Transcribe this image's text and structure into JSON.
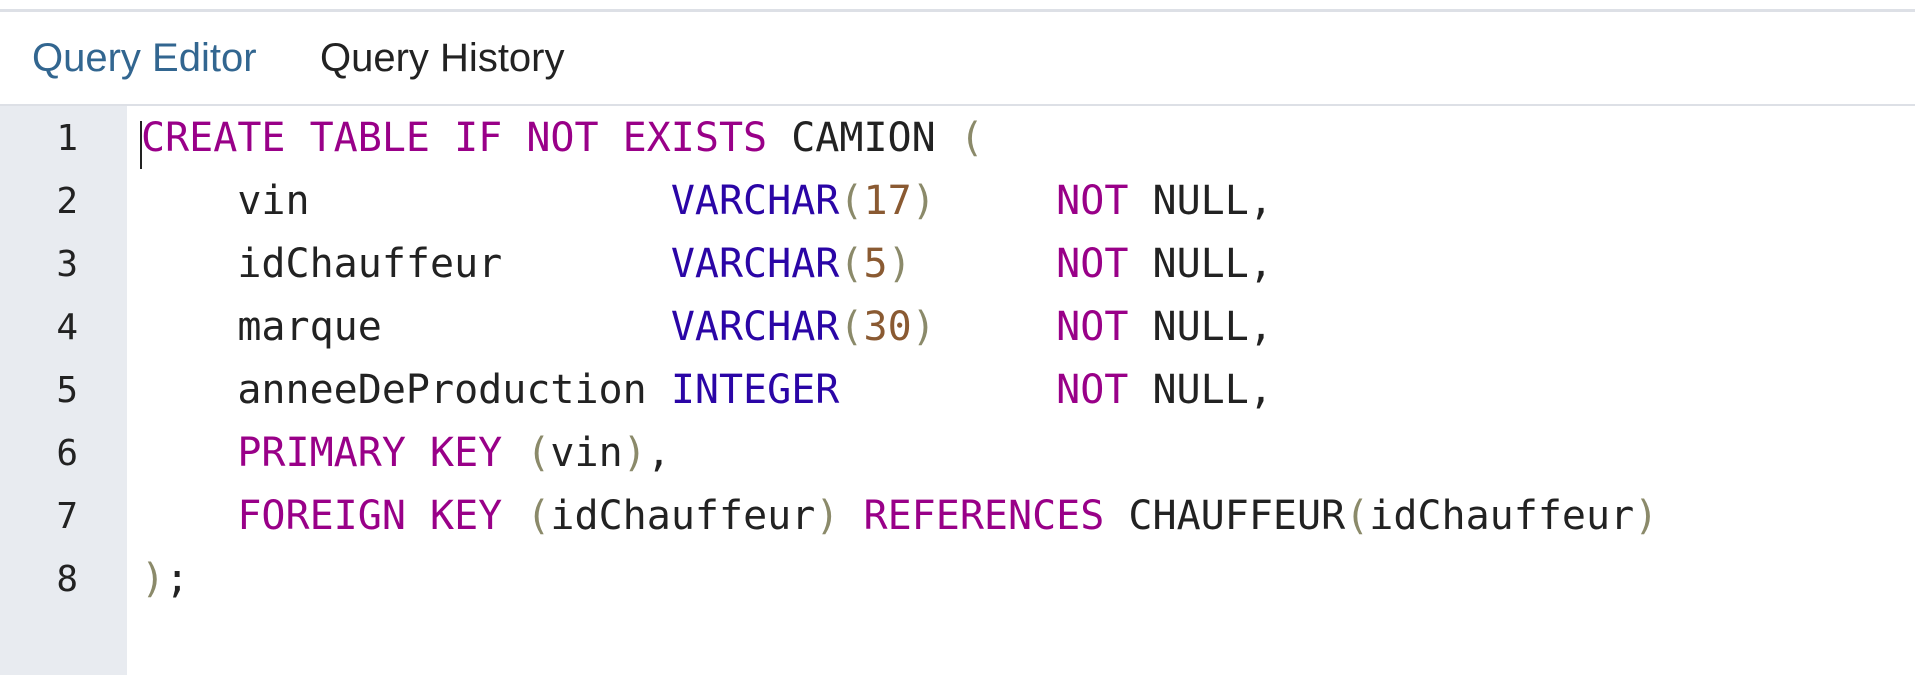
{
  "tabs": [
    {
      "label": "Query Editor",
      "active": true
    },
    {
      "label": "Query History",
      "active": false
    }
  ],
  "colors": {
    "accent": "#326690",
    "keyword": "#990088",
    "type": "#2a05a6",
    "number": "#8a5a32",
    "punctuation": "#8b8a6a",
    "gutter": "#e8ebf0"
  },
  "editor": {
    "line_numbers": [
      "1",
      "2",
      "3",
      "4",
      "5",
      "6",
      "7",
      "8"
    ],
    "lines": [
      [
        {
          "t": "CREATE TABLE IF NOT EXISTS",
          "c": "kw"
        },
        {
          "t": " CAMION ",
          "c": "tx"
        },
        {
          "t": "(",
          "c": "pn"
        }
      ],
      [
        {
          "t": "    vin               ",
          "c": "tx"
        },
        {
          "t": "VARCHAR",
          "c": "ty"
        },
        {
          "t": "(",
          "c": "pn"
        },
        {
          "t": "17",
          "c": "nm"
        },
        {
          "t": ")",
          "c": "pn"
        },
        {
          "t": "     ",
          "c": "tx"
        },
        {
          "t": "NOT",
          "c": "kw"
        },
        {
          "t": " NULL,",
          "c": "tx"
        }
      ],
      [
        {
          "t": "    idChauffeur       ",
          "c": "tx"
        },
        {
          "t": "VARCHAR",
          "c": "ty"
        },
        {
          "t": "(",
          "c": "pn"
        },
        {
          "t": "5",
          "c": "nm"
        },
        {
          "t": ")",
          "c": "pn"
        },
        {
          "t": "      ",
          "c": "tx"
        },
        {
          "t": "NOT",
          "c": "kw"
        },
        {
          "t": " NULL,",
          "c": "tx"
        }
      ],
      [
        {
          "t": "    marque            ",
          "c": "tx"
        },
        {
          "t": "VARCHAR",
          "c": "ty"
        },
        {
          "t": "(",
          "c": "pn"
        },
        {
          "t": "30",
          "c": "nm"
        },
        {
          "t": ")",
          "c": "pn"
        },
        {
          "t": "     ",
          "c": "tx"
        },
        {
          "t": "NOT",
          "c": "kw"
        },
        {
          "t": " NULL,",
          "c": "tx"
        }
      ],
      [
        {
          "t": "    anneeDeProduction ",
          "c": "tx"
        },
        {
          "t": "INTEGER",
          "c": "ty"
        },
        {
          "t": "         ",
          "c": "tx"
        },
        {
          "t": "NOT",
          "c": "kw"
        },
        {
          "t": " NULL,",
          "c": "tx"
        }
      ],
      [
        {
          "t": "    ",
          "c": "tx"
        },
        {
          "t": "PRIMARY KEY",
          "c": "kw"
        },
        {
          "t": " ",
          "c": "tx"
        },
        {
          "t": "(",
          "c": "pn"
        },
        {
          "t": "vin",
          "c": "tx"
        },
        {
          "t": ")",
          "c": "pn"
        },
        {
          "t": ",",
          "c": "tx"
        }
      ],
      [
        {
          "t": "    ",
          "c": "tx"
        },
        {
          "t": "FOREIGN KEY",
          "c": "kw"
        },
        {
          "t": " ",
          "c": "tx"
        },
        {
          "t": "(",
          "c": "pn"
        },
        {
          "t": "idChauffeur",
          "c": "tx"
        },
        {
          "t": ")",
          "c": "pn"
        },
        {
          "t": " ",
          "c": "tx"
        },
        {
          "t": "REFERENCES",
          "c": "kw"
        },
        {
          "t": " CHAUFFEUR",
          "c": "tx"
        },
        {
          "t": "(",
          "c": "pn"
        },
        {
          "t": "idChauffeur",
          "c": "tx"
        },
        {
          "t": ")",
          "c": "pn"
        }
      ],
      [
        {
          "t": ")",
          "c": "pn"
        },
        {
          "t": ";",
          "c": "tx"
        }
      ]
    ]
  }
}
